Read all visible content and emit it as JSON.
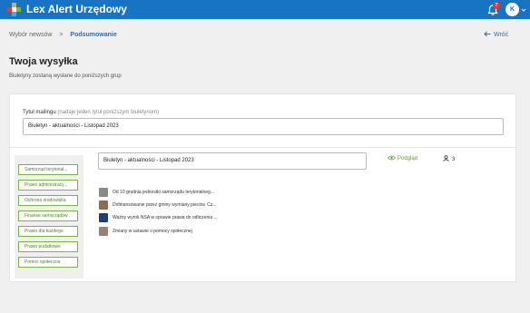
{
  "app": {
    "title": "Lex Alert Urzędowy",
    "notification_count": "7",
    "avatar_initials": "K"
  },
  "breadcrumb": {
    "items": [
      "Wybór newsów",
      "Podsumowanie"
    ],
    "separator": ">"
  },
  "back_label": "Wróć",
  "page": {
    "title": "Twoja wysyłka",
    "subtitle": "Biuletyny zostaną wysłane do poniższych grup"
  },
  "mailing": {
    "label": "Tytuł mailingu",
    "hint": "(nadaje jeden tytuł poniższym biuletynom)",
    "value": "Biuletyn - aktualności - Listopad 2023"
  },
  "groups": [
    "Samorząd terytorial...",
    "Prawo administracy...",
    "Ochrona środowiska",
    "Finanse samorządów",
    "Prawo dla każdego",
    "Prawo podatkowe",
    "Pomoc społeczna"
  ],
  "issue": {
    "title": "Biuletyn - aktualności - Listopad 2023",
    "preview_label": "Podgląd",
    "recipients_count": "3"
  },
  "articles": [
    {
      "title": "Od 10 grudnia jednostki samorządu terytorialneg...",
      "thumb": "#8a8a84"
    },
    {
      "title": "Dofinansowanie przez gminy wymiany pieców. Cz...",
      "thumb": "#8c6b4e"
    },
    {
      "title": "Ważny wyrok NSA w sprawie prawa do odliczenia ...",
      "thumb": "#1f3d7a"
    },
    {
      "title": "Zmiany w ustawie o pomocy społecznej",
      "thumb": "#9a7e7a"
    }
  ],
  "colors": {
    "topbar": "#1773c4",
    "accent_blue": "#1773c4",
    "group_green": "#7cb342",
    "preview_green": "#5a9e2a",
    "badge_red": "#e53935"
  },
  "icons": {
    "logo": "lex-logo-icon",
    "bell": "bell-icon",
    "back": "arrow-left-icon",
    "preview": "eye-icon",
    "recipients": "user-icon"
  }
}
